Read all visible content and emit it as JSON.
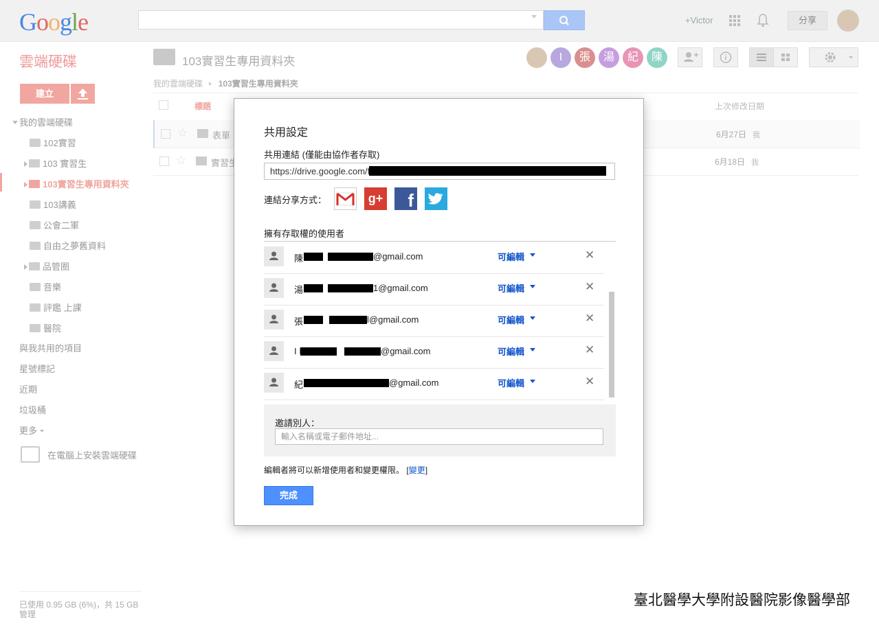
{
  "topbar": {
    "logo": [
      "G",
      "o",
      "o",
      "g",
      "l",
      "e"
    ],
    "user_name": "+Victor",
    "share_label": "分享"
  },
  "sidebar": {
    "title": "雲端硬碟",
    "create_label": "建立",
    "my_drive": "我的雲端硬碟",
    "folders": [
      "102實習",
      "103 實習生",
      "103實習生專用資料夾",
      "103講義",
      "公會二軍",
      "自由之夢舊資料",
      "品管圈",
      "音樂",
      "評鑑 上課",
      "醫院"
    ],
    "items": [
      "與我共用的項目",
      "星號標記",
      "近期",
      "垃圾桶",
      "更多"
    ],
    "install_label": "在電腦上安裝雲端硬碟",
    "storage": "已使用 0.95 GB (6%)，共 15 GB",
    "manage": "管理"
  },
  "main": {
    "folder_title": "103實習生專用資料夾",
    "breadcrumb_root": "我的雲端硬碟",
    "breadcrumb_current": "103實習生專用資料夾",
    "col_title": "標題",
    "col_modified": "上次修改日期",
    "share_avatars": [
      {
        "letter": "",
        "color": "#d9c7b4"
      },
      {
        "letter": "I",
        "color": "#b9a7e0"
      },
      {
        "letter": "張",
        "color": "#d98f8f"
      },
      {
        "letter": "湯",
        "color": "#c69ee0"
      },
      {
        "letter": "紀",
        "color": "#e895b5"
      },
      {
        "letter": "陳",
        "color": "#8fd5c6"
      }
    ],
    "files": [
      {
        "name": "表單",
        "date": "6月27日",
        "owner": "我"
      },
      {
        "name": "實習生",
        "date": "6月18日",
        "owner": "我"
      }
    ]
  },
  "dialog": {
    "title": "共用設定",
    "link_label": "共用連結 (僅能由協作者存取)",
    "link_value": "https://drive.google.com/f",
    "share_via_label": "連結分享方式：",
    "access_label": "擁有存取權的使用者",
    "users": [
      {
        "name": "陳",
        "email": "@gmail.com",
        "permission": "可編輯"
      },
      {
        "name": "湯",
        "email": "1@gmail.com",
        "permission": "可編輯"
      },
      {
        "name": "張",
        "email": "l@gmail.com",
        "permission": "可編輯"
      },
      {
        "name": "I I",
        "email": "@gmail.com",
        "permission": "可編輯"
      },
      {
        "name": "紀",
        "email": "@gmail.com",
        "permission": "可編輯"
      }
    ],
    "invite_label": "邀請別人：",
    "invite_placeholder": "輸入名稱或電子郵件地址...",
    "editor_note": "編輯者將可以新增使用者和變更權限。",
    "change_link": "變更",
    "done_label": "完成"
  },
  "footer": {
    "watermark": "臺北醫學大學附設醫院影像醫學部"
  }
}
